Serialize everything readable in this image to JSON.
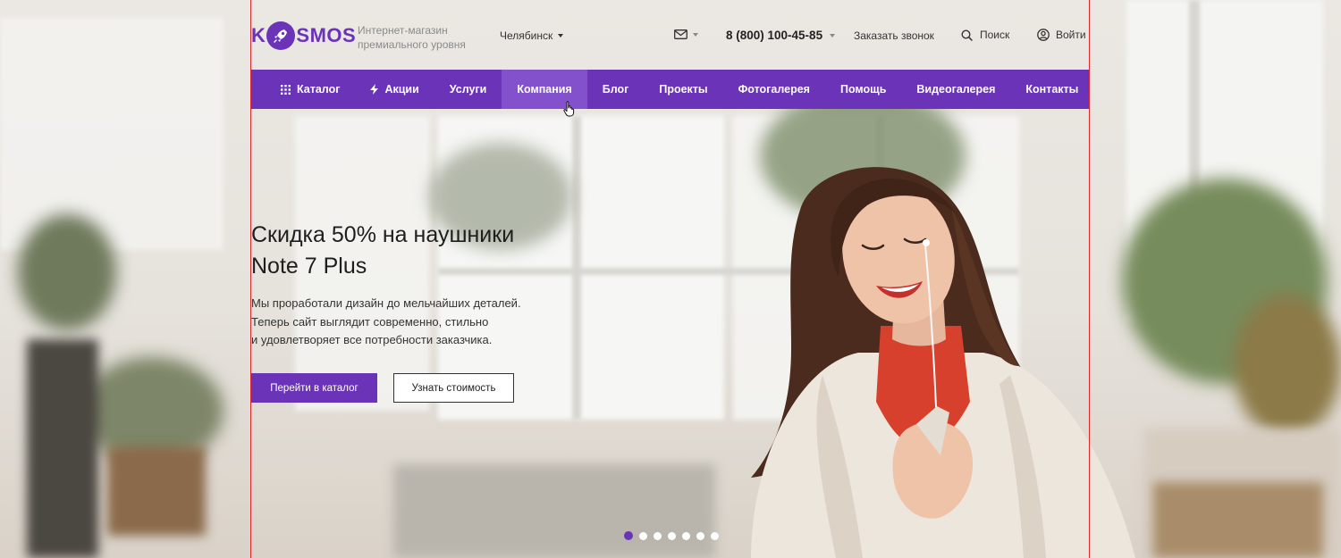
{
  "header": {
    "logo_left": "K",
    "logo_right": "SMOS",
    "tagline_line1": "Интернет-магазин",
    "tagline_line2": "премиального уровня",
    "city": "Челябинск",
    "phone": "8 (800) 100-45-85",
    "callback": "Заказать звонок",
    "search": "Поиск",
    "login": "Войти"
  },
  "nav": {
    "items": [
      {
        "label": "Каталог",
        "icon": "grid-icon"
      },
      {
        "label": "Акции",
        "icon": "lightning-icon"
      },
      {
        "label": "Услуги"
      },
      {
        "label": "Компания",
        "active": true
      },
      {
        "label": "Блог"
      },
      {
        "label": "Проекты"
      },
      {
        "label": "Фотогалерея"
      },
      {
        "label": "Помощь"
      },
      {
        "label": "Видеогалерея"
      },
      {
        "label": "Контакты"
      }
    ]
  },
  "hero": {
    "title_line1": "Скидка 50% на наушники",
    "title_line2": "Note 7 Plus",
    "text_line1": "Мы проработали дизайн до мельчайших деталей.",
    "text_line2": "Теперь сайт выглядит современно, стильно",
    "text_line3": "и удовлетворяет все потребности заказчика.",
    "btn_primary": "Перейти в каталог",
    "btn_secondary": "Узнать стоимость"
  },
  "slider": {
    "count": 7,
    "active_index": 0
  },
  "colors": {
    "accent": "#6a33b8",
    "nav_active": "#8451cc",
    "guide": "#e0262b"
  }
}
